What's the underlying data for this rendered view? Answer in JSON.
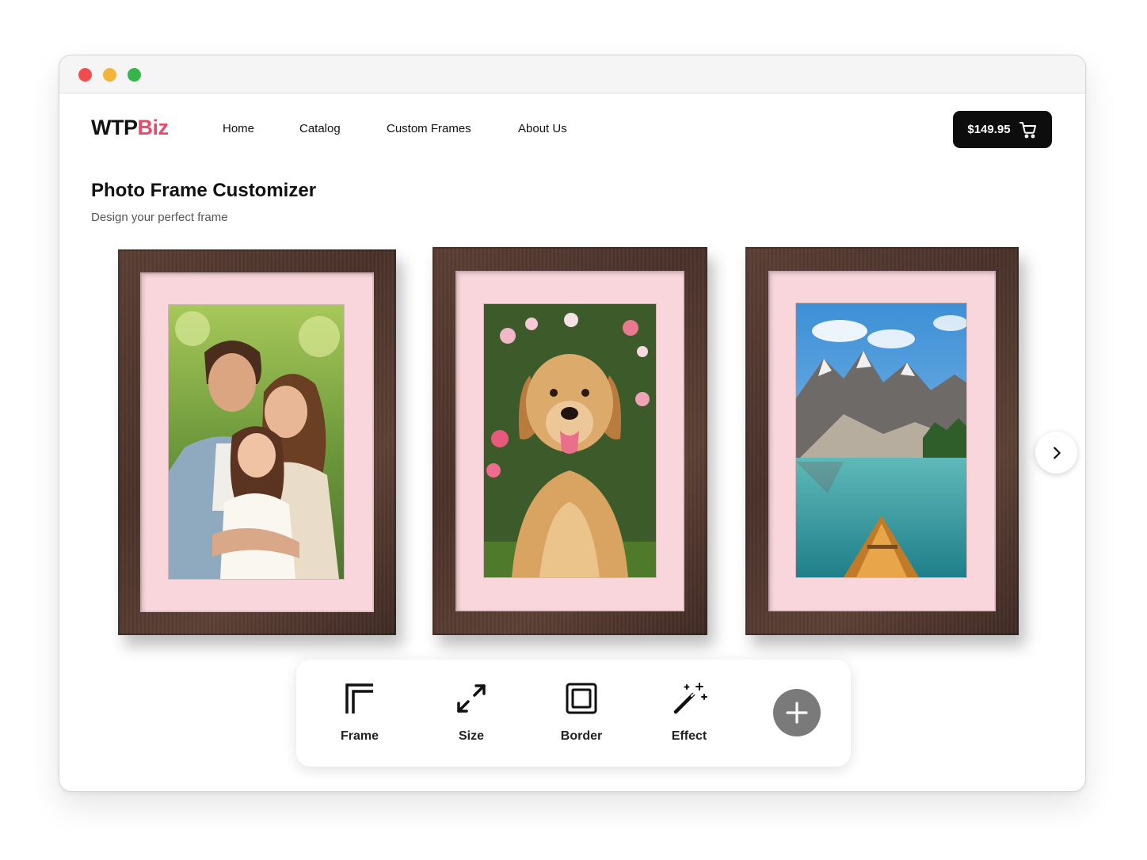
{
  "brand": {
    "name_part1": "WTP",
    "name_part2": "Biz",
    "accent_color": "#e84a6a"
  },
  "nav": {
    "items": [
      "Home",
      "Catalog",
      "Custom Frames",
      "About Us"
    ]
  },
  "cart": {
    "total": "$149.95",
    "icon": "cart-icon"
  },
  "page": {
    "title": "Photo Frame Customizer",
    "subtitle": "Design your perfect frame"
  },
  "frames": [
    {
      "photo": "family-portrait",
      "frame_color": "#4a322a",
      "mat_color": "#f8d6db"
    },
    {
      "photo": "golden-retriever",
      "frame_color": "#4a322a",
      "mat_color": "#f8d6db"
    },
    {
      "photo": "mountain-lake",
      "frame_color": "#4a322a",
      "mat_color": "#f8d6db"
    }
  ],
  "carousel": {
    "next_icon": "chevron-right-icon"
  },
  "toolbar": {
    "tools": [
      {
        "label": "Frame",
        "icon": "frame-corner-icon"
      },
      {
        "label": "Size",
        "icon": "resize-arrows-icon"
      },
      {
        "label": "Border",
        "icon": "border-square-icon"
      },
      {
        "label": "Effect",
        "icon": "magic-wand-icon"
      }
    ],
    "add_icon": "plus-icon"
  }
}
